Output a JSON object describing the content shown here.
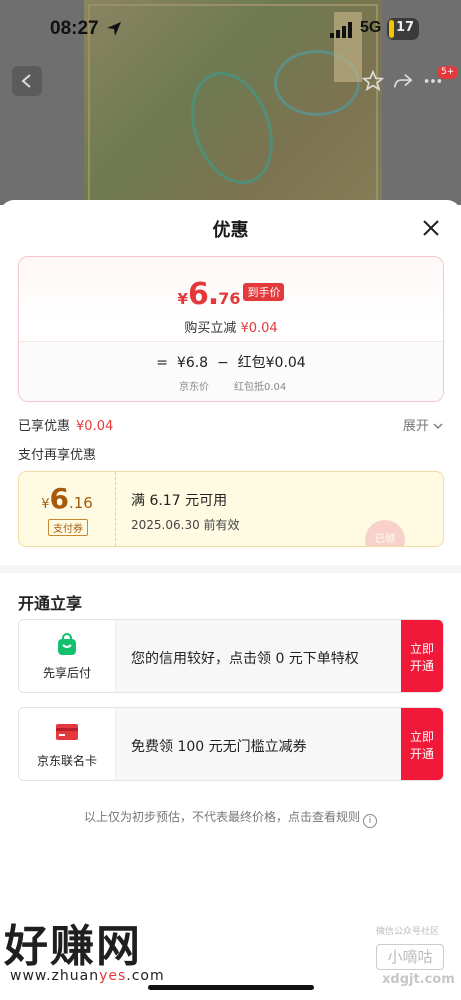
{
  "status_bar": {
    "time": "08:27",
    "network": "5G",
    "battery": "17"
  },
  "product_nav": {
    "badge": "5+"
  },
  "sheet": {
    "title": "优惠",
    "price": {
      "yen": "¥",
      "integer": "6.",
      "decimal": "76",
      "tag": "到手价",
      "buy_label": "购买立减",
      "buy_amount": "¥0.04",
      "formula_eq": "=",
      "jd_price": "¥6.8",
      "minus": "−",
      "hongbao_label": "红包",
      "hongbao_amount": "¥0.04",
      "jd_price_label": "京东价",
      "hongbao_sub": "红包抵0.04"
    },
    "enjoyed_label": "已享优惠",
    "enjoyed_amount": "¥0.04",
    "expand_label": "展开",
    "pay_more_label": "支付再享优惠",
    "pay_coupon": {
      "yen": "¥",
      "integer": "6",
      "decimal": ".16",
      "tag": "支付券",
      "condition": "满 6.17 元可用",
      "expiry": "2025.06.30 前有效",
      "stamp": "已领"
    },
    "open_title": "开通立享",
    "offers": [
      {
        "name": "先享后付",
        "desc": "您的信用较好，点击领 0 元下单特权",
        "btn_line1": "立即",
        "btn_line2": "开通",
        "icon": "shopping-bag-icon",
        "color": "#14c06e"
      },
      {
        "name": "京东联名卡",
        "desc": "免费领 100 元无门槛立减券",
        "btn_line1": "立即",
        "btn_line2": "开通",
        "icon": "credit-card-icon",
        "color": "#e4393c"
      }
    ],
    "note": "以上仅为初步预估，不代表最终价格，点击查看规则",
    "note_icon": "i"
  },
  "watermarks": {
    "left_title": "好赚网",
    "left_url_a": "www.zhuan",
    "left_url_b": "yes",
    "left_url_c": ".com",
    "right_top": "微信公众号社区",
    "right_title": "小嘀咕",
    "right_url": "xdgjt.com"
  }
}
